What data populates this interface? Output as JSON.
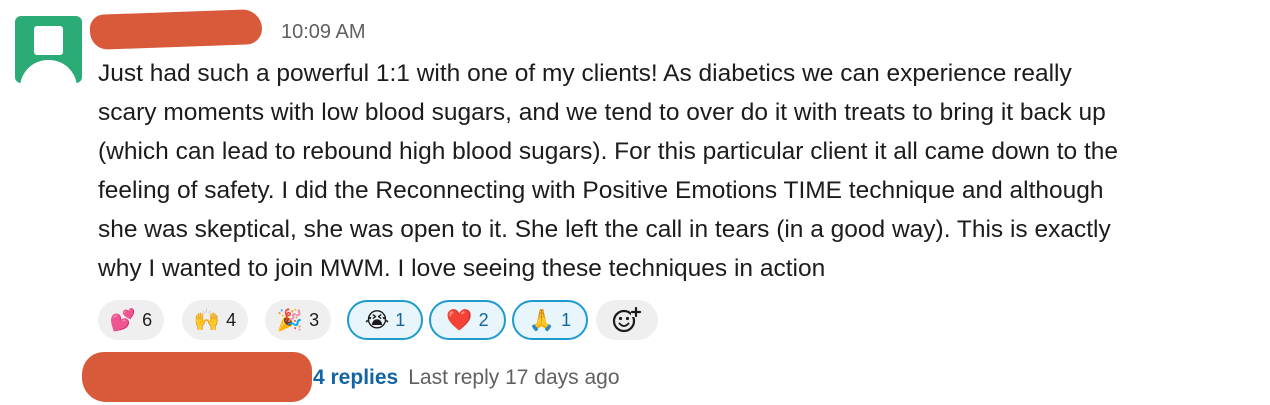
{
  "message": {
    "timestamp": "10:09 AM",
    "text_lines": [
      "Just had such a powerful 1:1 with one of my clients! As diabetics we can experience really",
      "scary moments with low blood sugars, and we tend to over do it with treats to bring it back up",
      "(which can lead to rebound high blood sugars). For this particular client it all came down to the",
      "feeling of safety. I did the Reconnecting with Positive Emotions TIME technique and although",
      "she was skeptical, she was open to it. She left the call in tears (in a good way). This is exactly",
      "why I wanted to join MWM. I love seeing these techniques in action"
    ],
    "reactions": [
      {
        "emoji": "💕",
        "icon": "two-hearts-icon",
        "count": "6",
        "active": false
      },
      {
        "emoji": "🙌",
        "icon": "raised-hands-icon",
        "count": "4",
        "active": false
      },
      {
        "emoji": "🎉",
        "icon": "party-popper-icon",
        "count": "3",
        "active": false
      },
      {
        "emoji": "😭",
        "icon": "loudly-crying-face-icon",
        "count": "1",
        "active": true
      },
      {
        "emoji": "❤️",
        "icon": "red-heart-icon",
        "count": "2",
        "active": true
      },
      {
        "emoji": "🙏",
        "icon": "folded-hands-icon",
        "count": "1",
        "active": true
      }
    ],
    "add_reaction_icon": "add-emoji-icon"
  },
  "thread": {
    "reply_count": "4 replies",
    "last_reply": "Last reply 17 days ago"
  },
  "colors": {
    "avatar": "#2bac76",
    "redaction": "#d85a3b",
    "link": "#1264a3",
    "active_reaction_border": "#1d9bd1",
    "active_reaction_bg": "#e8f5fa",
    "reaction_bg": "#efefef",
    "muted_text": "#616061"
  }
}
